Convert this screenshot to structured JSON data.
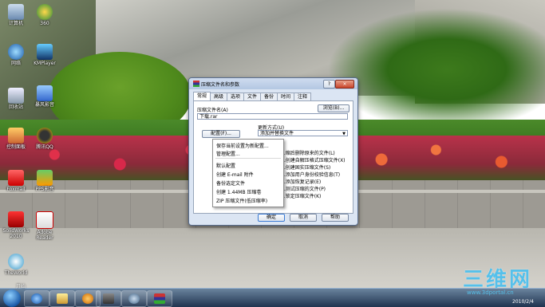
{
  "desktop": {
    "icons": [
      {
        "label": "计算机"
      },
      {
        "label": "360"
      },
      {
        "label": "网络"
      },
      {
        "label": "KMPlayer"
      },
      {
        "label": "回收站"
      },
      {
        "label": "暴风影音"
      },
      {
        "label": "控制面板"
      },
      {
        "label": "腾讯QQ"
      },
      {
        "label": "Foxmail"
      },
      {
        "label": "PPS影音"
      },
      {
        "label": "SolidWorks 2010"
      },
      {
        "label": "Adobe Reader"
      },
      {
        "label": "TheWorld"
      }
    ]
  },
  "dialog": {
    "title": "压缩文件名和参数",
    "help_btn": "?",
    "close_btn": "×",
    "tabs": [
      "常规",
      "高级",
      "选项",
      "文件",
      "备份",
      "时间",
      "注释"
    ],
    "archive_name_label": "压缩文件名(A)",
    "browse_btn": "浏览(B)...",
    "archive_name_value": "下载.rar",
    "profiles_btn": "配置(F)...",
    "update_mode_label": "更新方式(U)",
    "update_mode_value": "添加并替换文件",
    "options": [
      "...缩后删除原来的文件(L)",
      "...创建自解压格式压缩文件(X)",
      "...创建固实压缩文件(S)",
      "...添加用户身份校验信息(T)",
      "...添加恢复记录(E)",
      "...测试压缩的文件(P)",
      "...锁定压缩文件(K)"
    ],
    "ok_btn": "确定",
    "cancel_btn": "取消",
    "help_bottom_btn": "帮助"
  },
  "context_menu": {
    "items": [
      "保存当前设置为新配置...",
      "管理配置...",
      "默认配置",
      "创建 E-mail 附件",
      "备份选定文件",
      "创建 1.44MB 压缩卷",
      "ZIP 压缩文件(低压缩率)"
    ]
  },
  "watermark": {
    "text": "三维网",
    "sub": "www.3dportal.cn"
  },
  "taskbar": {
    "start_label": "开始",
    "date": "2010/2/4"
  }
}
